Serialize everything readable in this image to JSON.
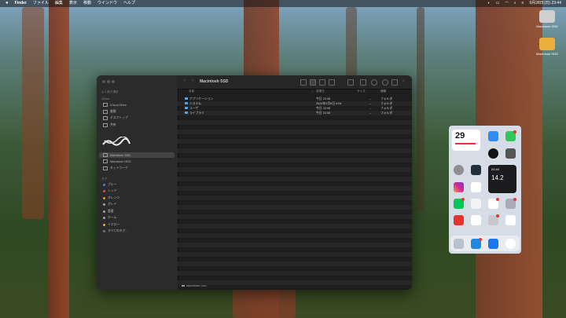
{
  "menubar": {
    "apple": "",
    "app_name": "Finder",
    "menus": [
      "ファイル",
      "編集",
      "表示",
      "移動",
      "ウインドウ",
      "ヘルプ"
    ],
    "clock": "9月28日(日) 23:44"
  },
  "desktop": {
    "icons": [
      {
        "label": "Macintosh SSD"
      },
      {
        "label": "Macintosh HDD"
      }
    ]
  },
  "finder": {
    "title": "Macintosh SSD",
    "sidebar": {
      "favorites_header": "よく使う項目",
      "icloud_header": "iCloud",
      "icloud_items": [
        "iCloud Drive",
        "書類",
        "デスクトップ",
        "共有"
      ],
      "locations": [
        "Macintosh SSD",
        "Macintosh HDD",
        "ネットワーク"
      ],
      "tags_header": "タグ",
      "tags": [
        {
          "label": "ブルー",
          "color": "#3b82f6"
        },
        {
          "label": "レッド",
          "color": "#ef4444"
        },
        {
          "label": "オレンジ",
          "color": "#f59e0b"
        },
        {
          "label": "グレイ",
          "color": "#9ca3af"
        },
        {
          "label": "重要",
          "color": "#9ca3af"
        },
        {
          "label": "ホーム",
          "color": "#9ca3af"
        },
        {
          "label": "イエロー",
          "color": "#eab308"
        },
        {
          "label": "すべてのタグ...",
          "color": "#6b7280"
        }
      ]
    },
    "columns": {
      "name": "名前",
      "date": "変更日",
      "size": "サイズ",
      "kind": "種類"
    },
    "rows": [
      {
        "name": "アプリケーション",
        "date": "今日 22:08",
        "size": "--",
        "kind": "フォルダ"
      },
      {
        "name": "システム",
        "date": "2024年9月6日 0:54",
        "size": "--",
        "kind": "フォルダ"
      },
      {
        "name": "ユーザ",
        "date": "今日 22:08",
        "size": "--",
        "kind": "フォルダ"
      },
      {
        "name": "ライブラリ",
        "date": "今日 22:08",
        "size": "--",
        "kind": "フォルダ"
      }
    ],
    "status_path": "Macintosh SSD"
  },
  "iphone": {
    "date_widget": "29",
    "weather_temp": "14.2",
    "weather_time": "22:44"
  }
}
